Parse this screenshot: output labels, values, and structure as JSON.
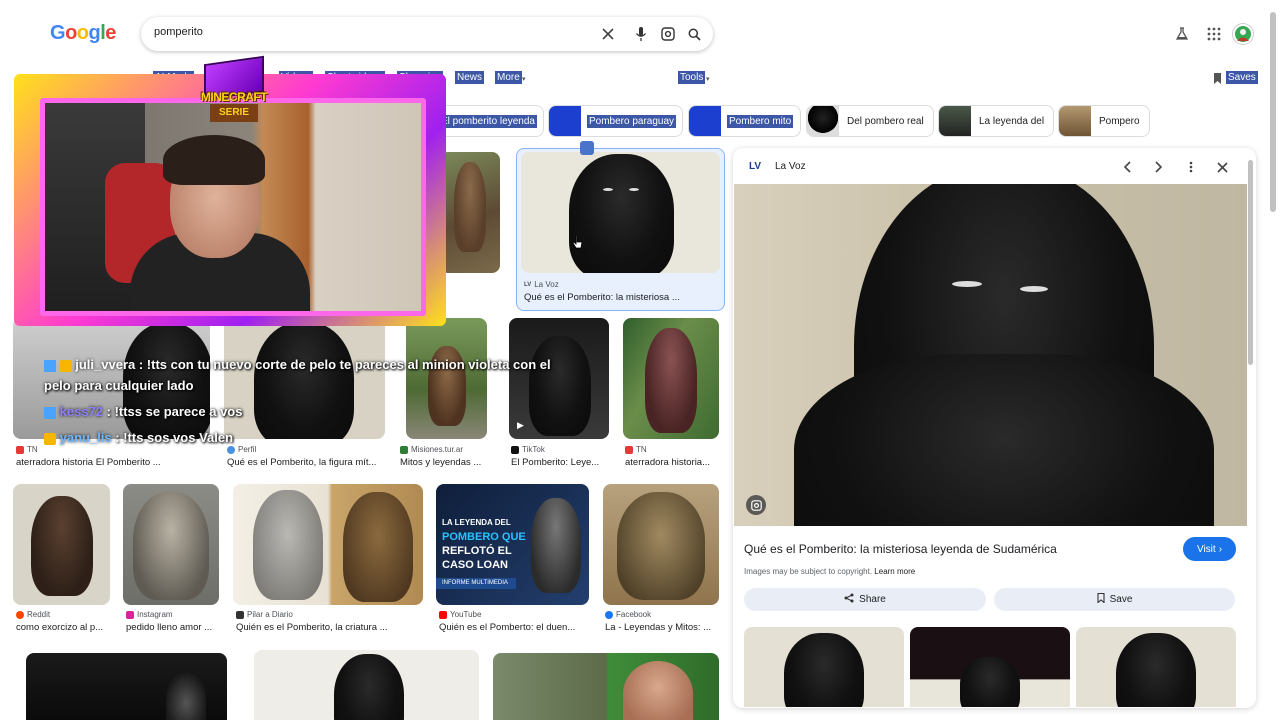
{
  "header": {
    "logo_letters": [
      "G",
      "o",
      "o",
      "g",
      "l",
      "e"
    ],
    "logo_colors": [
      "#4285f4",
      "#ea4335",
      "#fbbc05",
      "#4285f4",
      "#34a853",
      "#ea4335"
    ],
    "search_value": "pomperito",
    "icons": [
      "close-icon",
      "mic-icon",
      "lens-icon",
      "search-icon",
      "labs-icon",
      "apps-icon",
      "avatar"
    ]
  },
  "nav": {
    "items": [
      "AI Mode",
      "Videos",
      "Short videos",
      "Shopping",
      "News",
      "More"
    ],
    "tools": "Tools",
    "saves": "Saves"
  },
  "chips": [
    {
      "label": "El pomberito leyenda"
    },
    {
      "label": "Pombero paraguay"
    },
    {
      "label": "Pombero mito"
    },
    {
      "label": "Del pombero real"
    },
    {
      "label": "La leyenda del"
    },
    {
      "label": "Pompero"
    }
  ],
  "results": {
    "selected": {
      "source": "La Voz",
      "source_badge": "LV",
      "title": "Qué es el Pomberito: la misteriosa ..."
    },
    "row2": [
      {
        "source": "TN",
        "title": "aterradora historia El Pomberito ..."
      },
      {
        "source": "Perfil",
        "title": "Qué es el Pomberito, la figura mít..."
      },
      {
        "source": "Misiones.tur.ar",
        "title": "Mitos y leyendas ..."
      },
      {
        "source": "TikTok",
        "title": "El Pomberito: Leye..."
      },
      {
        "source": "TN",
        "title": "aterradora historia..."
      }
    ],
    "row3": [
      {
        "source": "Reddit",
        "title": "como exorcizo al p..."
      },
      {
        "source": "Instagram",
        "title": "pedido lleno amor ..."
      },
      {
        "source": "Pilar a Diario",
        "title": "Quién es el Pomberito, la criatura ..."
      },
      {
        "source": "YouTube",
        "title": "Quién es el Pomberto: el duen..."
      },
      {
        "source": "Facebook",
        "title": "La - Leyendas y Mitos: ..."
      }
    ],
    "youtube_thumb_lines": [
      "LA LEYENDA DEL",
      "POMBERO QUE",
      "REFLOTÓ EL",
      "CASO LOAN"
    ],
    "youtube_thumb_footer": "INFORME MULTIMEDIA"
  },
  "panel": {
    "source_badge": "LV",
    "source": "La Voz",
    "title": "Qué es el Pomberito: la misteriosa leyenda de Sudamérica",
    "visit": "Visit",
    "copyright": "Images may be subject to copyright.",
    "learn_more": "Learn more",
    "share": "Share",
    "save": "Save"
  },
  "overlay": {
    "badge_line1": "MINECRAFT",
    "badge_line2": "SERIE",
    "chat": [
      {
        "user": "juli_vvera",
        "text": " : !tts con tu nuevo corte de pelo te pareces al minion violeta con el",
        "user_color": "#ffffff"
      },
      {
        "user": "",
        "text": "pelo para cualquier lado",
        "user_color": "#ffffff"
      },
      {
        "user": "kess72",
        "text": " : !ttss se parece a vos",
        "user_color": "#8a7fff"
      },
      {
        "user": "yanu_lis",
        "text": " : !tts sos vos Valen",
        "user_color": "#6fb7ff"
      }
    ]
  },
  "colors": {
    "accent": "#1a73e8",
    "selection": "#3b57a6",
    "overlay_pink": "#ff67ea",
    "overlay_yellow": "#ffe11a"
  }
}
